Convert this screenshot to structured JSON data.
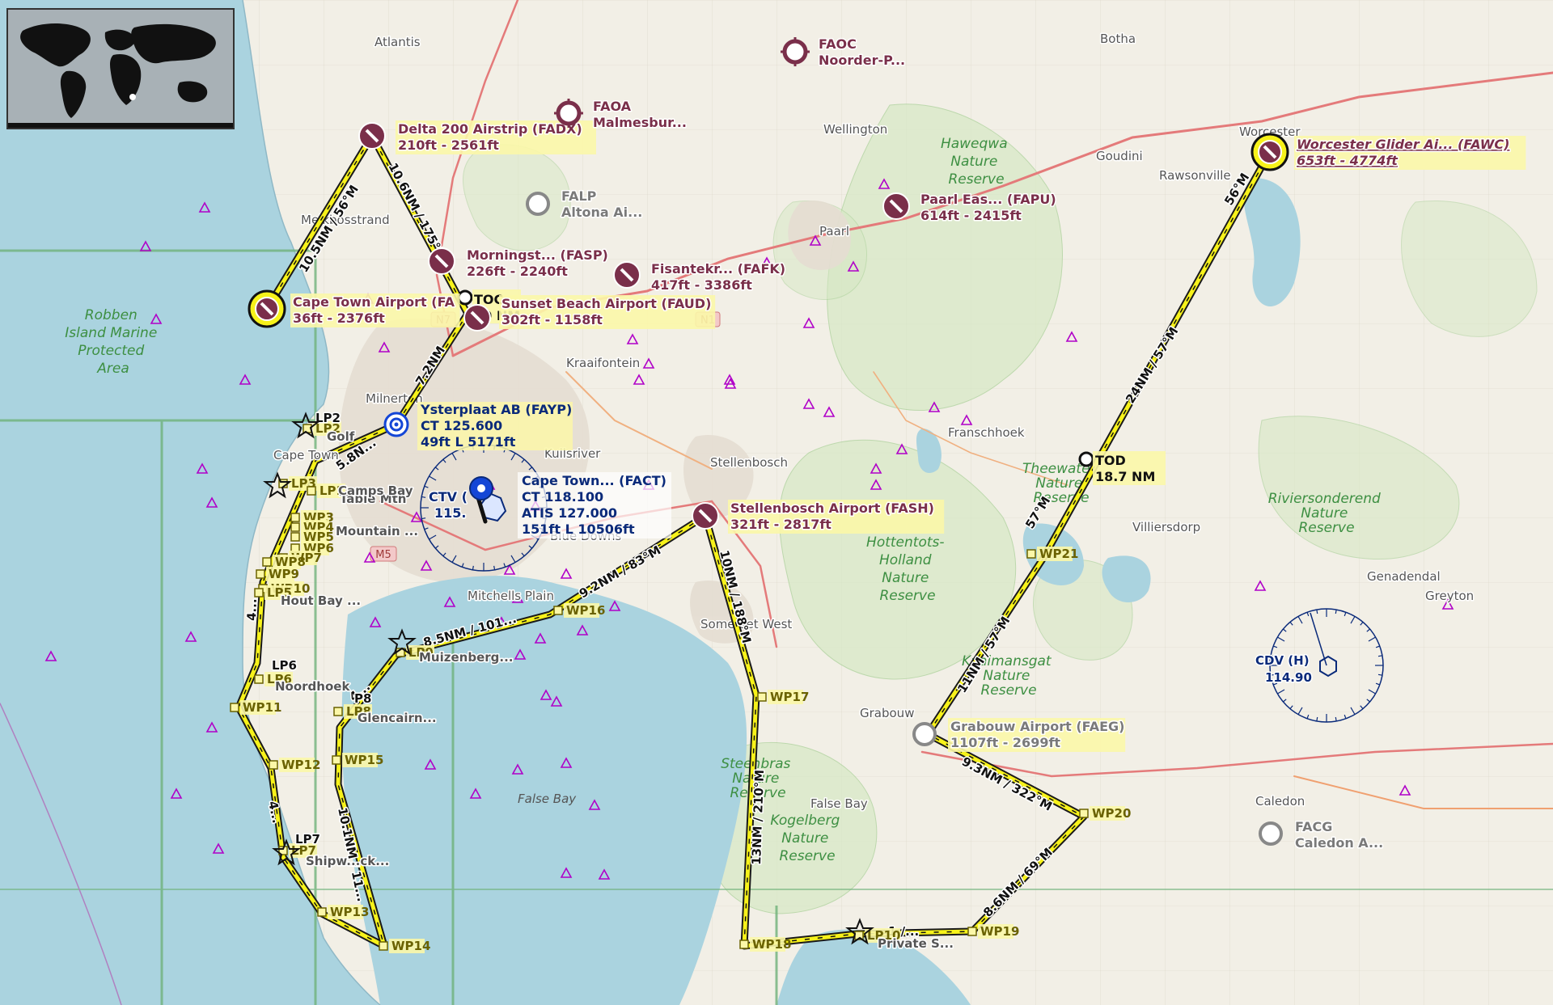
{
  "colors": {
    "sea": "#aad3df",
    "land": "#f2efe6",
    "park": "#d6e8c4",
    "route": "#f7f21a",
    "route_outline": "#1a1a1a",
    "airport_dark": "#7a2f4a",
    "airport_label": "#7a2f4a",
    "navaid": "#0a2a7a",
    "label_bg": "#fbf7a8",
    "waypoint_triangle": "#b000c8"
  },
  "overview": {
    "icon": "world-map-icon"
  },
  "airports": [
    {
      "id": "fadx",
      "name": "Delta 200 Airstrip (FADX)",
      "sub": "210ft - 2561ft",
      "hl": true
    },
    {
      "id": "fact_main",
      "name": "Cape Town Airport (FA",
      "sub": "36ft - 2376ft",
      "hl": true
    },
    {
      "id": "fasp",
      "name": "Morningst... (FASP)",
      "sub": "226ft - 2240ft",
      "hl": false
    },
    {
      "id": "faud",
      "name": "Sunset Beach Airport (FAUD)",
      "sub": "302ft - 1158ft",
      "hl": true
    },
    {
      "id": "fafk",
      "name": "Fisantekr... (FAFK)",
      "sub": "417ft - 3386ft",
      "hl": false
    },
    {
      "id": "fapu",
      "name": "Paarl Eas... (FAPU)",
      "sub": "614ft - 2415ft",
      "hl": false
    },
    {
      "id": "faoc",
      "name": "FAOC",
      "sub": "Noorder-P...",
      "hl": false
    },
    {
      "id": "faoa",
      "name": "FAOA",
      "sub": "Malmesbur...",
      "hl": false
    },
    {
      "id": "falp",
      "name": "FALP",
      "sub": "Altona Ai...",
      "hl": false
    },
    {
      "id": "fawc",
      "name": "Worcester Glider Ai... (FAWC)",
      "sub": "653ft - 4774ft",
      "hl": true
    },
    {
      "id": "fash",
      "name": "Stellenbosch Airport (FASH)",
      "sub": "321ft - 2817ft",
      "hl": true
    },
    {
      "id": "faeg",
      "name": "Grabouw Airport (FAEG)",
      "sub": "1107ft - 2699ft",
      "hl": true
    },
    {
      "id": "facg",
      "name": "FACG",
      "sub": "Caledon A...",
      "hl": false
    }
  ],
  "fayp": {
    "name": "Ysterplaat AB (FAYP)",
    "freq": "CT 125.600",
    "sub": "49ft L 5171ft"
  },
  "fact": {
    "name": "Cape Town... (FACT)",
    "ct": "CT 118.100",
    "atis": "ATIS 127.000",
    "sub": "151ft L 10506ft"
  },
  "navaids": {
    "ctv": {
      "label": "CTV (",
      "freq": "115."
    },
    "cdv": {
      "label": "CDV (H)",
      "freq": "114.90"
    }
  },
  "toc": {
    "label": "TOC",
    "dist": "20 NM"
  },
  "tod": {
    "label": "TOD",
    "dist": "18.7 NM"
  },
  "waypoints": [
    "LP2",
    "LP3",
    "LP1",
    "WP3",
    "WP4",
    "WP5",
    "WP6",
    "WP7",
    "WP8",
    "WP9",
    "WP10",
    "LP5",
    "LP6",
    "WP11",
    "WP12",
    "LP7",
    "WP13",
    "WP14",
    "WP15",
    "LP8",
    "LP9",
    "WP16",
    "WP17",
    "WP18",
    "LP10",
    "WP19",
    "WP20",
    "WP21"
  ],
  "wp_extra": {
    "lp6_top": "LP6",
    "lp7_top": "LP7",
    "lp8_top": "P8",
    "lp2_top": "LP2"
  },
  "legs": [
    "10.5NM / 56°M",
    "10.6NM / 175°M",
    "7.2NM",
    "5.8N...",
    "9.2NM / 83°M",
    "8.5NM / 101...",
    "10NM / 188°M",
    "13NM / 210°M",
    "24NM / 57°M",
    "56°M",
    "57°M",
    "11NM / 57°M",
    "9.3NM / 322°M",
    "8.6NM / 69°M",
    "10.1NM / 11...",
    "4...",
    "4...",
    "4...",
    "1 /..."
  ],
  "places": [
    "Atlantis",
    "Botha",
    "Wellington",
    "Goudini",
    "Rawsonville",
    "Worcester",
    "Paarl",
    "Kraaifontein",
    "Milnerton",
    "Franschhoek",
    "Stellenbosch",
    "Kuilsriver",
    "Mitchells Plain",
    "Somerset West",
    "Blue Downs",
    "Villiersdorp",
    "Genadendal",
    "Greyton",
    "Caledon",
    "Grabouw",
    "Melkbosstrand",
    "Muizenberg...",
    "Glencairn...",
    "Noordhoek",
    "Hout Bay ...",
    "Shipw...ck...",
    "Private S...",
    "Golf",
    "Table Mtn",
    "Mountain ...",
    "Camps Bay",
    "Cape Town",
    "N7",
    "N1",
    "M5",
    "False Bay"
  ],
  "parks": [
    [
      "Robben",
      "Island Marine",
      "Protected",
      "Area"
    ],
    [
      "Haweqwa",
      "Nature",
      "Reserve"
    ],
    [
      "Hottentots-",
      "Holland",
      "Nature",
      "Reserve"
    ],
    [
      "Kogelberg",
      "Nature",
      "Reserve"
    ],
    [
      "Riviersonderend",
      "Nature",
      "Reserve"
    ],
    [
      "Theewater",
      "Nature",
      "Reserve"
    ],
    [
      "Steenbras",
      "Nature",
      "Reserve"
    ],
    [
      "Kaaimansgat",
      "Nature",
      "Reserve"
    ]
  ]
}
